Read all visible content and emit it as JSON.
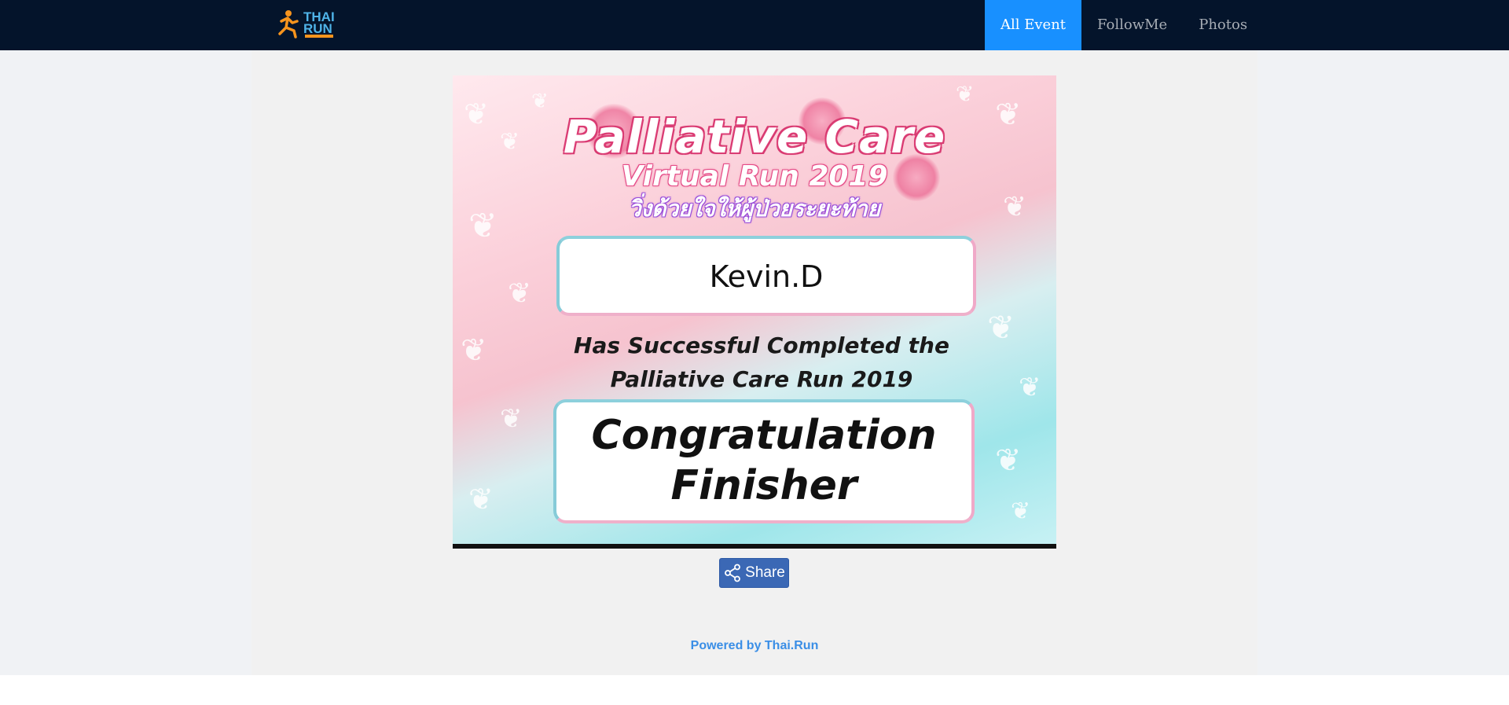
{
  "nav": {
    "logo_top": "THAI",
    "logo_bottom": "RUN",
    "items": [
      {
        "label": "All Event",
        "active": true
      },
      {
        "label": "FollowMe",
        "active": false
      },
      {
        "label": "Photos",
        "active": false
      }
    ]
  },
  "certificate": {
    "title": "Palliative Care",
    "subtitle": "Virtual Run 2019",
    "thai_text": "วิ่งด้วยใจให้ผู้ป่วยระยะท้าย",
    "runner_name": "Kevin.D",
    "completed_line1": "Has Successful Completed the",
    "completed_line2": "Palliative Care Run 2019",
    "congrats_line1": "Congratulation",
    "congrats_line2": "Finisher"
  },
  "share": {
    "label": "Share",
    "icon": "share-icon"
  },
  "footer": {
    "powered_by": "Powered by Thai.Run"
  },
  "colors": {
    "navbar": "#04142b",
    "nav_active": "#1890ff",
    "share_button": "#3b68b5",
    "footer_link": "#3a8ee6"
  }
}
